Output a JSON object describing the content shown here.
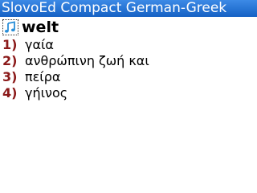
{
  "app": {
    "title": "SlovoEd Compact German-Greek"
  },
  "entry": {
    "headword": "welt",
    "sound_icon": "music-note-icon",
    "senses": [
      {
        "number": "1)",
        "text": "γαία"
      },
      {
        "number": "2)",
        "text": "ανθρώπινη ζωή και"
      },
      {
        "number": "3)",
        "text": "πείρα"
      },
      {
        "number": "4)",
        "text": "γήινος"
      }
    ]
  },
  "colors": {
    "titlebar": "#1f6fd1",
    "sense_number": "#8b1a1a",
    "icon_blue": "#2a8fd8"
  }
}
